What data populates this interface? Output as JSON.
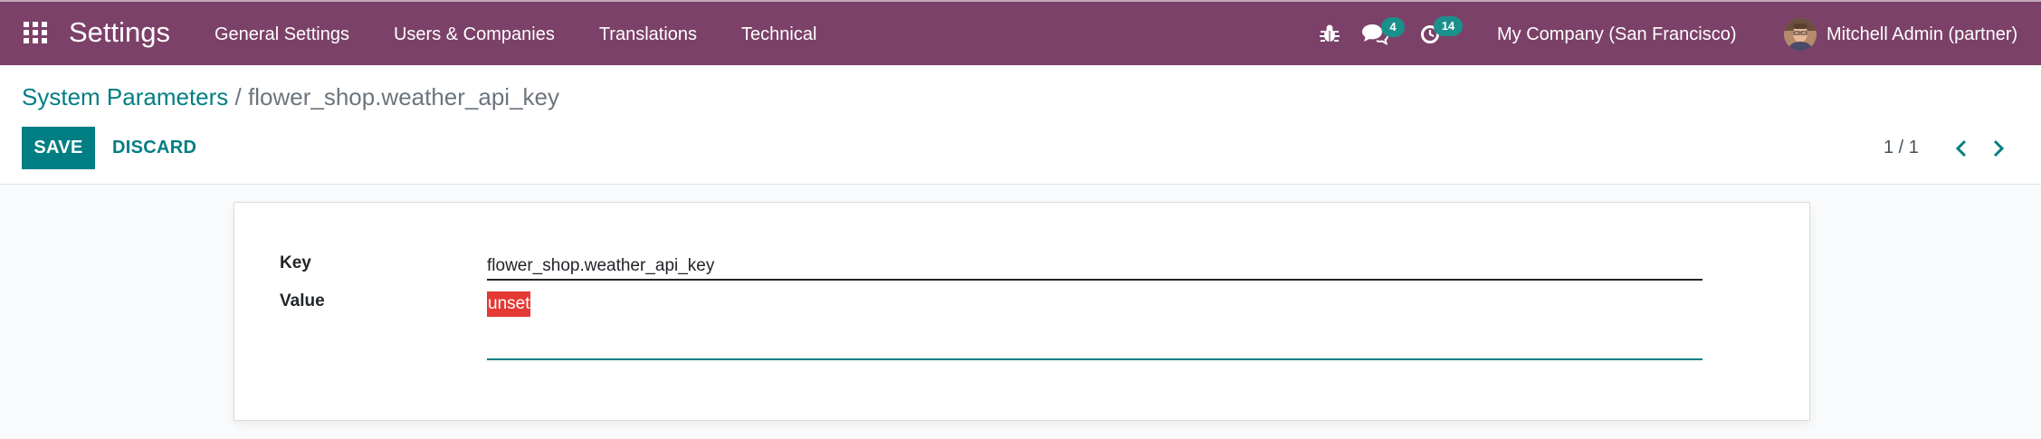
{
  "navbar": {
    "app_title": "Settings",
    "menu": [
      "General Settings",
      "Users & Companies",
      "Translations",
      "Technical"
    ],
    "messages_count": "4",
    "activities_count": "14",
    "company": "My Company (San Francisco)",
    "user": "Mitchell Admin (partner)",
    "bg_color": "#7c4168",
    "icons": [
      "apps-grid-icon",
      "bug-icon",
      "chat-icon",
      "clock-icon"
    ]
  },
  "control_panel": {
    "breadcrumb_parent": "System Parameters",
    "breadcrumb_separator": "/",
    "breadcrumb_current": "flower_shop.weather_api_key",
    "save_label": "SAVE",
    "discard_label": "DISCARD",
    "pager_value": "1 / 1",
    "accent_color": "#017e84"
  },
  "form": {
    "key_label": "Key",
    "key_value": "flower_shop.weather_api_key",
    "value_label": "Value",
    "value_value": "unset"
  }
}
